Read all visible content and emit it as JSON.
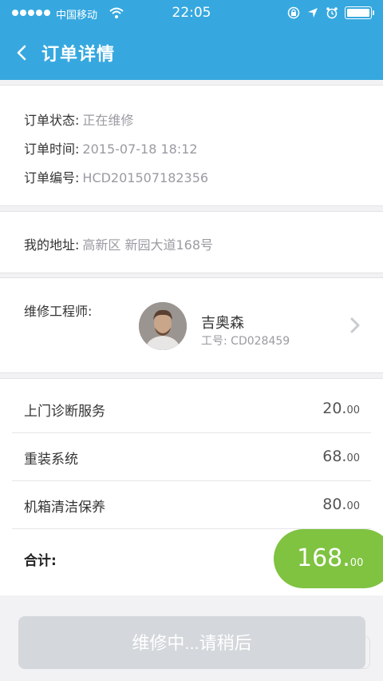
{
  "status_bar": {
    "carrier": "中国移动",
    "time": "22:05",
    "battery_level": 1.0
  },
  "header": {
    "title": "订单详情"
  },
  "order": {
    "status_label": "订单状态:",
    "status_value": "正在维修",
    "time_label": "订单时间:",
    "time_value": "2015-07-18 18:12",
    "number_label": "订单编号:",
    "number_value": "HCD201507182356"
  },
  "address": {
    "label": "我的地址:",
    "value": "高新区 新园大道168号"
  },
  "engineer": {
    "label": "维修工程师:",
    "name": "吉奥森",
    "id_text": "工号: CD028459"
  },
  "services": [
    {
      "name": "上门诊断服务",
      "price_int": "20.",
      "price_dec": "00"
    },
    {
      "name": "重装系统",
      "price_int": "68.",
      "price_dec": "00"
    },
    {
      "name": "机箱清洁保养",
      "price_int": "80.",
      "price_dec": "00"
    }
  ],
  "total": {
    "label": "合计:",
    "amount_int": "168.",
    "amount_dec": "00"
  },
  "action": {
    "button_label": "维修中...请稍后"
  },
  "colors": {
    "primary": "#36a8df",
    "total_pill": "#7fc341",
    "button_disabled": "#d4d7db"
  }
}
